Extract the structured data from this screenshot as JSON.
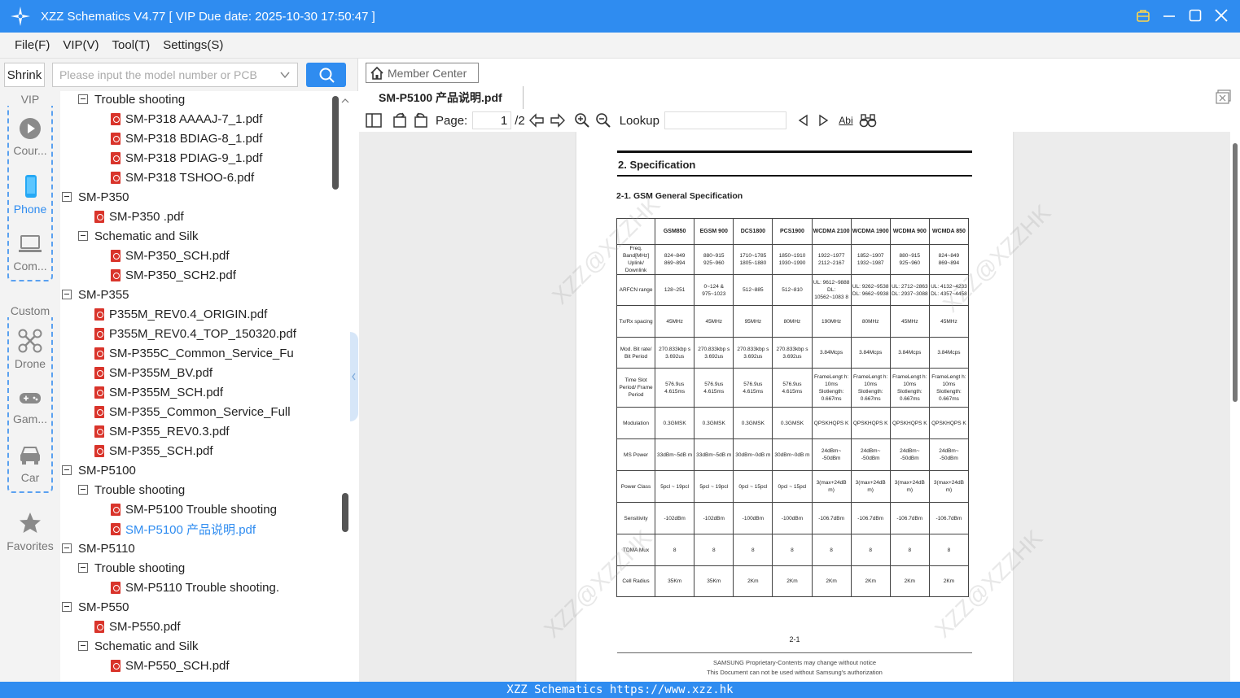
{
  "window": {
    "title": "XZZ Schematics V4.77 [ VIP Due date: 2025-10-30 17:50:47 ]"
  },
  "menu": [
    "File(F)",
    "VIP(V)",
    "Tool(T)",
    "Settings(S)"
  ],
  "search": {
    "shrink_label": "Shrink",
    "placeholder": "Please input the model number or PCB"
  },
  "nav": {
    "vip_label": "VIP",
    "course_label": "Cour...",
    "phone_label": "Phone",
    "computer_label": "Com...",
    "custom_label": "Custom",
    "drone_label": "Drone",
    "game_label": "Gam...",
    "car_label": "Car",
    "favorites_label": "Favorites"
  },
  "tree": [
    {
      "type": "folder",
      "level": 1,
      "label": "Trouble shooting"
    },
    {
      "type": "pdf",
      "level": 2,
      "label": "SM-P318 AAAAJ-7_1.pdf"
    },
    {
      "type": "pdf",
      "level": 2,
      "label": "SM-P318 BDIAG-8_1.pdf"
    },
    {
      "type": "pdf",
      "level": 2,
      "label": "SM-P318 PDIAG-9_1.pdf"
    },
    {
      "type": "pdf",
      "level": 2,
      "label": "SM-P318 TSHOO-6.pdf"
    },
    {
      "type": "folder",
      "level": 0,
      "label": "SM-P350"
    },
    {
      "type": "pdf",
      "level": 1,
      "label": "SM-P350 .pdf"
    },
    {
      "type": "folder",
      "level": 1,
      "label": "Schematic and Silk"
    },
    {
      "type": "pdf",
      "level": 2,
      "label": "SM-P350_SCH.pdf"
    },
    {
      "type": "pdf",
      "level": 2,
      "label": "SM-P350_SCH2.pdf"
    },
    {
      "type": "folder",
      "level": 0,
      "label": "SM-P355"
    },
    {
      "type": "pdf",
      "level": 1,
      "label": "P355M_REV0.4_ORIGIN.pdf"
    },
    {
      "type": "pdf",
      "level": 1,
      "label": "P355M_REV0.4_TOP_150320.pdf"
    },
    {
      "type": "pdf",
      "level": 1,
      "label": "SM-P355C_Common_Service_Fu"
    },
    {
      "type": "pdf",
      "level": 1,
      "label": "SM-P355M_BV.pdf"
    },
    {
      "type": "pdf",
      "level": 1,
      "label": "SM-P355M_SCH.pdf"
    },
    {
      "type": "pdf",
      "level": 1,
      "label": "SM-P355_Common_Service_Full"
    },
    {
      "type": "pdf",
      "level": 1,
      "label": "SM-P355_REV0.3.pdf"
    },
    {
      "type": "pdf",
      "level": 1,
      "label": "SM-P355_SCH.pdf"
    },
    {
      "type": "folder",
      "level": 0,
      "label": "SM-P5100"
    },
    {
      "type": "folder",
      "level": 1,
      "label": "Trouble shooting"
    },
    {
      "type": "pdf",
      "level": 2,
      "label": "SM-P5100 Trouble shooting"
    },
    {
      "type": "pdf",
      "level": 2,
      "label": "SM-P5100 产品说明.pdf",
      "selected": true
    },
    {
      "type": "folder",
      "level": 0,
      "label": "SM-P5110"
    },
    {
      "type": "folder",
      "level": 1,
      "label": "Trouble shooting"
    },
    {
      "type": "pdf",
      "level": 2,
      "label": "SM-P5110 Trouble shooting."
    },
    {
      "type": "folder",
      "level": 0,
      "label": "SM-P550"
    },
    {
      "type": "pdf",
      "level": 1,
      "label": "SM-P550.pdf"
    },
    {
      "type": "folder",
      "level": 1,
      "label": "Schematic and Silk"
    },
    {
      "type": "pdf",
      "level": 2,
      "label": "SM-P550_SCH.pdf"
    }
  ],
  "viewer": {
    "member_center_label": "Member Center",
    "tab_title": "SM-P5100 产品说明.pdf",
    "page_label": "Page:",
    "page_current": "1",
    "page_total": "/2",
    "lookup_label": "Lookup",
    "abi_label": "Abi"
  },
  "document": {
    "heading": "2.  Specification",
    "subheading": "2-1.  GSM  General  Specification",
    "columns": [
      "",
      "GSM850",
      "EGSM  900",
      "DCS1800",
      "PCS1900",
      "WCDMA 2100",
      "WCDMA 1900",
      "WCDMA 900",
      "WCMDA 850"
    ],
    "rows": [
      [
        "Freq. Band[MHz] Uplink/ Downlink",
        "824~849 869~894",
        "880~915 925~960",
        "1710~1785 1805~1880",
        "1850~1910 1930~1990",
        "1922~1977 2112~2167",
        "1852~1907 1932~1987",
        "880~915 925~960",
        "824~849 869~894"
      ],
      [
        "ARFCN range",
        "128~251",
        "0~124 & 975~1023",
        "512~885",
        "512~810",
        "UL: 9612~9888 DL: 10562~1083 8",
        "UL: 9262~9538 DL: 9662~9938",
        "UL: 2712~2863 DL: 2937~3088",
        "UL: 4132~4233 DL: 4357~4458"
      ],
      [
        "Tx/Rx spacing",
        "45MHz",
        "45MHz",
        "95MHz",
        "80MHz",
        "190MHz",
        "80MHz",
        "45MHz",
        "45MHz"
      ],
      [
        "Mod. Bit rate/ Bit Period",
        "270.833kbp s 3.692us",
        "270.833kbp s 3.692us",
        "270.833kbp s 3.692us",
        "270.833kbp s 3.692us",
        "3.84Mcps",
        "3.84Mcps",
        "3.84Mcps",
        "3.84Mcps"
      ],
      [
        "Time Slot Period/ Frame Period",
        "576.9us 4.615ms",
        "576.9us 4.615ms",
        "576.9us 4.615ms",
        "576.9us 4.615ms",
        "FrameLengt h: 10ms Slotlength: 0.667ms",
        "FrameLengt h: 10ms Slotlength: 0.667ms",
        "FrameLengt h: 10ms Slotlength: 0.667ms",
        "FrameLengt h: 10ms Slotlength: 0.667ms"
      ],
      [
        "Modulation",
        "0.3GMSK",
        "0.3GMSK",
        "0.3GMSK",
        "0.3GMSK",
        "QPSKHQPS K",
        "QPSKHQPS K",
        "QPSKHQPS K",
        "QPSKHQPS K"
      ],
      [
        "MS Power",
        "33dBm~5dB m",
        "33dBm~5dB m",
        "30dBm~0dB m",
        "30dBm~0dB m",
        "24dBm~ -50dBm",
        "24dBm~ -50dBm",
        "24dBm~ -50dBm",
        "24dBm~ -50dBm"
      ],
      [
        "Power Class",
        "5pcl ~ 19pcl",
        "5pcl ~ 19pcl",
        "0pcl ~ 15pcl",
        "0pcl ~ 15pcl",
        "3(max+24dB m)",
        "3(max+24dB m)",
        "3(max+24dB m)",
        "3(max+24dB m)"
      ],
      [
        "Sensitivity",
        "-102dBm",
        "-102dBm",
        "-100dBm",
        "-100dBm",
        "-106.7dBm",
        "-106.7dBm",
        "-106.7dBm",
        "-106.7dBm"
      ],
      [
        "TDMA Mux",
        "8",
        "8",
        "8",
        "8",
        "8",
        "8",
        "8",
        "8"
      ],
      [
        "Cell Radius",
        "35Km",
        "35Km",
        "2Km",
        "2Km",
        "2Km",
        "2Km",
        "2Km",
        "2Km"
      ]
    ],
    "page_number": "2-1",
    "footer_line1": "SAMSUNG Proprietary-Contents may change without notice",
    "footer_line2": "This Document can not be used without Samsung's authorization",
    "watermark": "XZZ@XZZHK"
  },
  "status_bar": "XZZ Schematics https://www.xzz.hk",
  "colors": {
    "accent": "#2f8cf0",
    "pdf_icon": "#d9342b"
  }
}
